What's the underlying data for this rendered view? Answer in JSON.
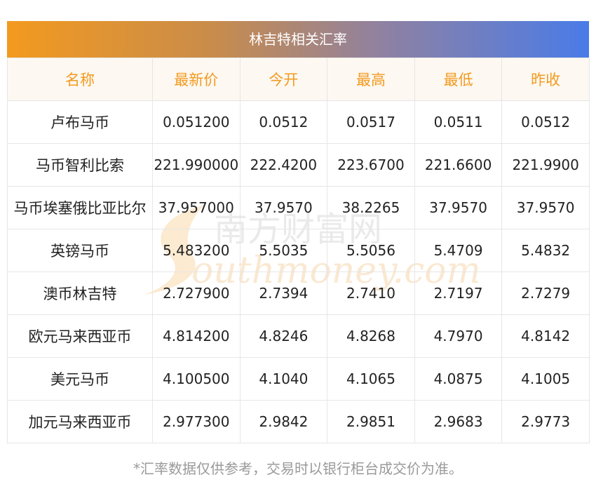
{
  "title": "林吉特相关汇率",
  "headers": [
    "名称",
    "最新价",
    "今开",
    "最高",
    "最低",
    "昨收"
  ],
  "rows": [
    [
      "卢布马币",
      "0.051200",
      "0.0512",
      "0.0517",
      "0.0511",
      "0.0512"
    ],
    [
      "马币智利比索",
      "221.990000",
      "222.4200",
      "223.6700",
      "221.6600",
      "221.9900"
    ],
    [
      "马币埃塞俄比亚比尔",
      "37.957000",
      "37.9570",
      "38.2265",
      "37.9570",
      "37.9570"
    ],
    [
      "英镑马币",
      "5.483200",
      "5.5035",
      "5.5056",
      "5.4709",
      "5.4832"
    ],
    [
      "澳币林吉特",
      "2.727900",
      "2.7394",
      "2.7410",
      "2.7197",
      "2.7279"
    ],
    [
      "欧元马来西亚币",
      "4.814200",
      "4.8246",
      "4.8268",
      "4.7970",
      "4.8142"
    ],
    [
      "美元马币",
      "4.100500",
      "4.1040",
      "4.1065",
      "4.0875",
      "4.1005"
    ],
    [
      "加元马来西亚币",
      "2.977300",
      "2.9842",
      "2.9851",
      "2.9683",
      "2.9773"
    ]
  ],
  "watermark": {
    "cn": "南方财富网",
    "en": "outhmoney.com"
  },
  "footer": "*汇率数据仅供参考，交易时以银行柜台成交价为准。",
  "colors": {
    "header_text": "#f39a1f",
    "gradient_start": "#f39a1f",
    "gradient_end": "#4a7be8"
  }
}
